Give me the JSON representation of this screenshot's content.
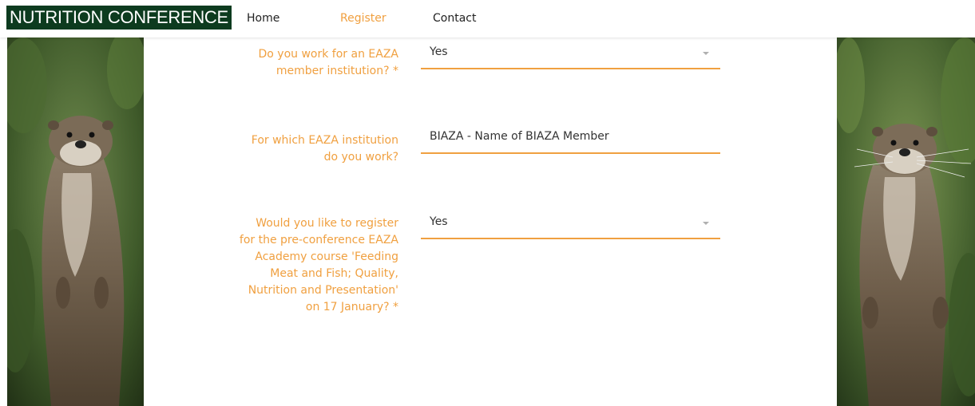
{
  "header": {
    "brand": "NUTRITION CONFERENCE",
    "nav": [
      {
        "label": "Home"
      },
      {
        "label": "Register"
      },
      {
        "label": "Contact"
      }
    ]
  },
  "form": {
    "fields": [
      {
        "label": "Do you work for an EAZA member institution? *",
        "value": "Yes",
        "type": "select"
      },
      {
        "label": "For which EAZA institution do you work?",
        "value": "BIAZA - Name of BIAZA Member",
        "type": "text"
      },
      {
        "label": "Would you like to register for the pre-conference EAZA Academy course 'Feeding Meat and Fish; Quality, Nutrition and Presentation' on 17 January? *",
        "value": "Yes",
        "type": "select"
      }
    ]
  },
  "colors": {
    "accent": "#f0a040",
    "brand_bg": "#0d3b1f"
  }
}
